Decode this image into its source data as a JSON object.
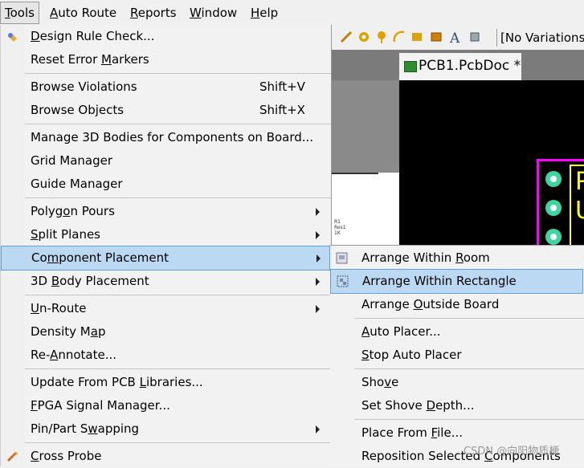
{
  "menubar": {
    "items": [
      "Tools",
      "Auto Route",
      "Reports",
      "Window",
      "Help"
    ],
    "ul": [
      "T",
      "A",
      "R",
      "W",
      "H"
    ]
  },
  "toolbar": {
    "variations": "[No Variations"
  },
  "document": {
    "tab": "PCB1.PcbDoc *"
  },
  "pcb": {
    "text_top": "P",
    "text_bottom": "U"
  },
  "schematic": {
    "r_label": "R1",
    "r_value": "Res1",
    "r_k": "1K"
  },
  "menu": {
    "items": [
      {
        "pre": "",
        "u": "D",
        "post": "esign Rule Check...",
        "shortcut": ""
      },
      {
        "pre": "Reset Error ",
        "u": "M",
        "post": "arkers",
        "shortcut": ""
      },
      {
        "pre": "Browse Violations",
        "u": "",
        "post": "",
        "shortcut": "Shift+V"
      },
      {
        "pre": "Browse Objects",
        "u": "",
        "post": "",
        "shortcut": "Shift+X"
      },
      {
        "pre": "Manage 3D Bodies for Components on Board...",
        "u": "",
        "post": "",
        "shortcut": ""
      },
      {
        "pre": "Grid Manager",
        "u": "",
        "post": "",
        "shortcut": ""
      },
      {
        "pre": "Guide Manager",
        "u": "",
        "post": "",
        "shortcut": ""
      },
      {
        "pre": "Polyg",
        "u": "o",
        "post": "n Pours",
        "shortcut": ""
      },
      {
        "pre": "",
        "u": "S",
        "post": "plit Planes",
        "shortcut": ""
      },
      {
        "pre": "Co",
        "u": "m",
        "post": "ponent Placement",
        "shortcut": ""
      },
      {
        "pre": "3D ",
        "u": "B",
        "post": "ody Placement",
        "shortcut": ""
      },
      {
        "pre": "",
        "u": "U",
        "post": "n-Route",
        "shortcut": ""
      },
      {
        "pre": "Density M",
        "u": "a",
        "post": "p",
        "shortcut": ""
      },
      {
        "pre": "Re-",
        "u": "A",
        "post": "nnotate...",
        "shortcut": ""
      },
      {
        "pre": "Update From PCB ",
        "u": "L",
        "post": "ibraries...",
        "shortcut": ""
      },
      {
        "pre": "",
        "u": "F",
        "post": "PGA Signal Manager...",
        "shortcut": ""
      },
      {
        "pre": "Pin/Part S",
        "u": "w",
        "post": "apping",
        "shortcut": ""
      },
      {
        "pre": "",
        "u": "C",
        "post": "ross Probe",
        "shortcut": ""
      }
    ]
  },
  "submenu": {
    "items": [
      {
        "pre": "Arrange Within ",
        "u": "R",
        "post": "oom"
      },
      {
        "pre": "Arrange Within Rectan",
        "u": "g",
        "post": "le"
      },
      {
        "pre": "Arrange ",
        "u": "O",
        "post": "utside Board"
      },
      {
        "pre": "",
        "u": "A",
        "post": "uto Placer..."
      },
      {
        "pre": "",
        "u": "S",
        "post": "top Auto Placer"
      },
      {
        "pre": "Sho",
        "u": "v",
        "post": "e"
      },
      {
        "pre": "Set Shove ",
        "u": "D",
        "post": "epth..."
      },
      {
        "pre": "Place From ",
        "u": "F",
        "post": "ile..."
      },
      {
        "pre": "Reposition Selected ",
        "u": "C",
        "post": "omponents"
      }
    ]
  },
  "watermark": "CSDN @向阳物质梗"
}
